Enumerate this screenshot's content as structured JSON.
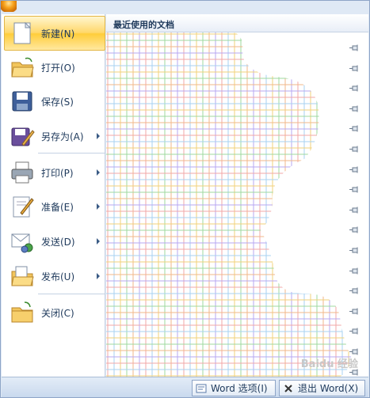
{
  "menu": {
    "items": [
      {
        "label": "新建(N)",
        "icon": "new-document-icon",
        "selected": true,
        "has_submenu": false
      },
      {
        "label": "打开(O)",
        "icon": "open-folder-icon",
        "selected": false,
        "has_submenu": false
      },
      {
        "label": "保存(S)",
        "icon": "save-icon",
        "selected": false,
        "has_submenu": false
      },
      {
        "label": "另存为(A)",
        "icon": "save-as-icon",
        "selected": false,
        "has_submenu": true
      },
      {
        "label": "打印(P)",
        "icon": "print-icon",
        "selected": false,
        "has_submenu": true
      },
      {
        "label": "准备(E)",
        "icon": "prepare-icon",
        "selected": false,
        "has_submenu": true
      },
      {
        "label": "发送(D)",
        "icon": "send-icon",
        "selected": false,
        "has_submenu": true
      },
      {
        "label": "发布(U)",
        "icon": "publish-icon",
        "selected": false,
        "has_submenu": true
      },
      {
        "label": "关闭(C)",
        "icon": "close-folder-icon",
        "selected": false,
        "has_submenu": false
      }
    ]
  },
  "recent": {
    "title": "最近使用的文档",
    "pin_icon": "pin-icon"
  },
  "bottom": {
    "options_label": "Word 选项(I)",
    "exit_label": "退出 Word(X)"
  },
  "watermark": "Baidu 经验",
  "colors": {
    "accent": "#ffd86b",
    "panel_bg": "#dfe9f5",
    "text": "#1e395b"
  }
}
